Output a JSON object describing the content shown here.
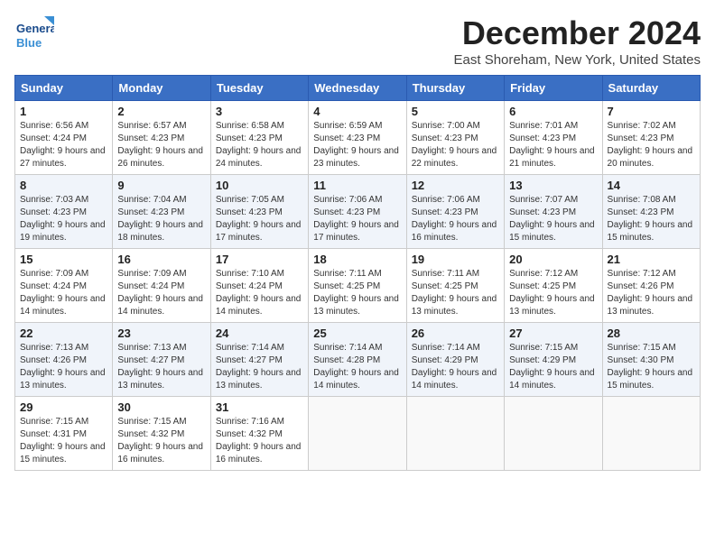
{
  "logo": {
    "line1": "General",
    "line2": "Blue"
  },
  "title": "December 2024",
  "location": "East Shoreham, New York, United States",
  "weekdays": [
    "Sunday",
    "Monday",
    "Tuesday",
    "Wednesday",
    "Thursday",
    "Friday",
    "Saturday"
  ],
  "weeks": [
    [
      {
        "day": 1,
        "sunrise": "6:56 AM",
        "sunset": "4:24 PM",
        "daylight": "9 hours and 27 minutes."
      },
      {
        "day": 2,
        "sunrise": "6:57 AM",
        "sunset": "4:23 PM",
        "daylight": "9 hours and 26 minutes."
      },
      {
        "day": 3,
        "sunrise": "6:58 AM",
        "sunset": "4:23 PM",
        "daylight": "9 hours and 24 minutes."
      },
      {
        "day": 4,
        "sunrise": "6:59 AM",
        "sunset": "4:23 PM",
        "daylight": "9 hours and 23 minutes."
      },
      {
        "day": 5,
        "sunrise": "7:00 AM",
        "sunset": "4:23 PM",
        "daylight": "9 hours and 22 minutes."
      },
      {
        "day": 6,
        "sunrise": "7:01 AM",
        "sunset": "4:23 PM",
        "daylight": "9 hours and 21 minutes."
      },
      {
        "day": 7,
        "sunrise": "7:02 AM",
        "sunset": "4:23 PM",
        "daylight": "9 hours and 20 minutes."
      }
    ],
    [
      {
        "day": 8,
        "sunrise": "7:03 AM",
        "sunset": "4:23 PM",
        "daylight": "9 hours and 19 minutes."
      },
      {
        "day": 9,
        "sunrise": "7:04 AM",
        "sunset": "4:23 PM",
        "daylight": "9 hours and 18 minutes."
      },
      {
        "day": 10,
        "sunrise": "7:05 AM",
        "sunset": "4:23 PM",
        "daylight": "9 hours and 17 minutes."
      },
      {
        "day": 11,
        "sunrise": "7:06 AM",
        "sunset": "4:23 PM",
        "daylight": "9 hours and 17 minutes."
      },
      {
        "day": 12,
        "sunrise": "7:06 AM",
        "sunset": "4:23 PM",
        "daylight": "9 hours and 16 minutes."
      },
      {
        "day": 13,
        "sunrise": "7:07 AM",
        "sunset": "4:23 PM",
        "daylight": "9 hours and 15 minutes."
      },
      {
        "day": 14,
        "sunrise": "7:08 AM",
        "sunset": "4:23 PM",
        "daylight": "9 hours and 15 minutes."
      }
    ],
    [
      {
        "day": 15,
        "sunrise": "7:09 AM",
        "sunset": "4:24 PM",
        "daylight": "9 hours and 14 minutes."
      },
      {
        "day": 16,
        "sunrise": "7:09 AM",
        "sunset": "4:24 PM",
        "daylight": "9 hours and 14 minutes."
      },
      {
        "day": 17,
        "sunrise": "7:10 AM",
        "sunset": "4:24 PM",
        "daylight": "9 hours and 14 minutes."
      },
      {
        "day": 18,
        "sunrise": "7:11 AM",
        "sunset": "4:25 PM",
        "daylight": "9 hours and 13 minutes."
      },
      {
        "day": 19,
        "sunrise": "7:11 AM",
        "sunset": "4:25 PM",
        "daylight": "9 hours and 13 minutes."
      },
      {
        "day": 20,
        "sunrise": "7:12 AM",
        "sunset": "4:25 PM",
        "daylight": "9 hours and 13 minutes."
      },
      {
        "day": 21,
        "sunrise": "7:12 AM",
        "sunset": "4:26 PM",
        "daylight": "9 hours and 13 minutes."
      }
    ],
    [
      {
        "day": 22,
        "sunrise": "7:13 AM",
        "sunset": "4:26 PM",
        "daylight": "9 hours and 13 minutes."
      },
      {
        "day": 23,
        "sunrise": "7:13 AM",
        "sunset": "4:27 PM",
        "daylight": "9 hours and 13 minutes."
      },
      {
        "day": 24,
        "sunrise": "7:14 AM",
        "sunset": "4:27 PM",
        "daylight": "9 hours and 13 minutes."
      },
      {
        "day": 25,
        "sunrise": "7:14 AM",
        "sunset": "4:28 PM",
        "daylight": "9 hours and 14 minutes."
      },
      {
        "day": 26,
        "sunrise": "7:14 AM",
        "sunset": "4:29 PM",
        "daylight": "9 hours and 14 minutes."
      },
      {
        "day": 27,
        "sunrise": "7:15 AM",
        "sunset": "4:29 PM",
        "daylight": "9 hours and 14 minutes."
      },
      {
        "day": 28,
        "sunrise": "7:15 AM",
        "sunset": "4:30 PM",
        "daylight": "9 hours and 15 minutes."
      }
    ],
    [
      {
        "day": 29,
        "sunrise": "7:15 AM",
        "sunset": "4:31 PM",
        "daylight": "9 hours and 15 minutes."
      },
      {
        "day": 30,
        "sunrise": "7:15 AM",
        "sunset": "4:32 PM",
        "daylight": "9 hours and 16 minutes."
      },
      {
        "day": 31,
        "sunrise": "7:16 AM",
        "sunset": "4:32 PM",
        "daylight": "9 hours and 16 minutes."
      },
      null,
      null,
      null,
      null
    ]
  ],
  "labels": {
    "sunrise": "Sunrise:",
    "sunset": "Sunset:",
    "daylight": "Daylight:"
  }
}
